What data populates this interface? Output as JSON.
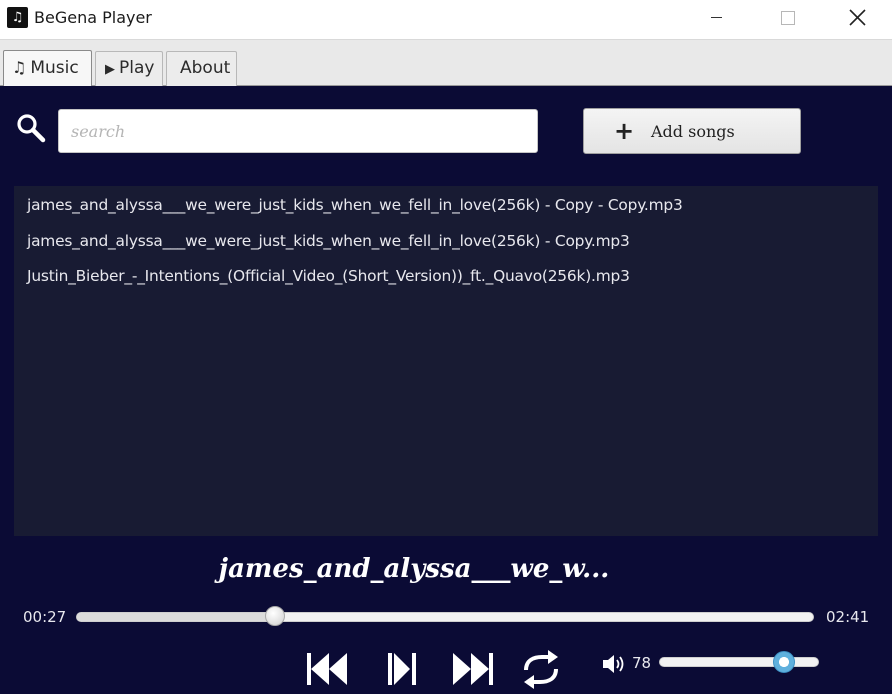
{
  "window": {
    "title": "BeGena Player",
    "app_icon": "music-note-icon"
  },
  "tabs": [
    {
      "label": "Music",
      "icon": "music-notes-icon",
      "active": true
    },
    {
      "label": "Play",
      "icon": "play-triangle-icon",
      "active": false
    },
    {
      "label": "About",
      "active": false
    }
  ],
  "search": {
    "placeholder": "search",
    "value": ""
  },
  "add_button": {
    "icon": "plus-icon",
    "label": "Add songs"
  },
  "songs": [
    {
      "name": "james_and_alyssa___we_were_just_kids_when_we_fell_in_love(256k) - Copy - Copy.mp3"
    },
    {
      "name": "james_and_alyssa___we_were_just_kids_when_we_fell_in_love(256k) - Copy.mp3"
    },
    {
      "name": "Justin_Bieber_-_Intentions_(Official_Video_(Short_Version))_ft._Quavo(256k).mp3"
    }
  ],
  "now_playing": {
    "title": "james_and_alyssa___we_w..."
  },
  "progress": {
    "elapsed": "00:27",
    "total": "02:41",
    "fraction": 0.27
  },
  "controls": {
    "prev_icon": "skip-previous-icon",
    "playpause_icon": "play-pause-icon",
    "next_icon": "skip-next-icon",
    "repeat_icon": "repeat-icon"
  },
  "volume": {
    "icon": "speaker-icon",
    "value": "78",
    "fraction": 0.78
  },
  "colors": {
    "background": "#0b0b35",
    "list_background": "#181b33",
    "volume_thumb": "#5fb0dd"
  }
}
